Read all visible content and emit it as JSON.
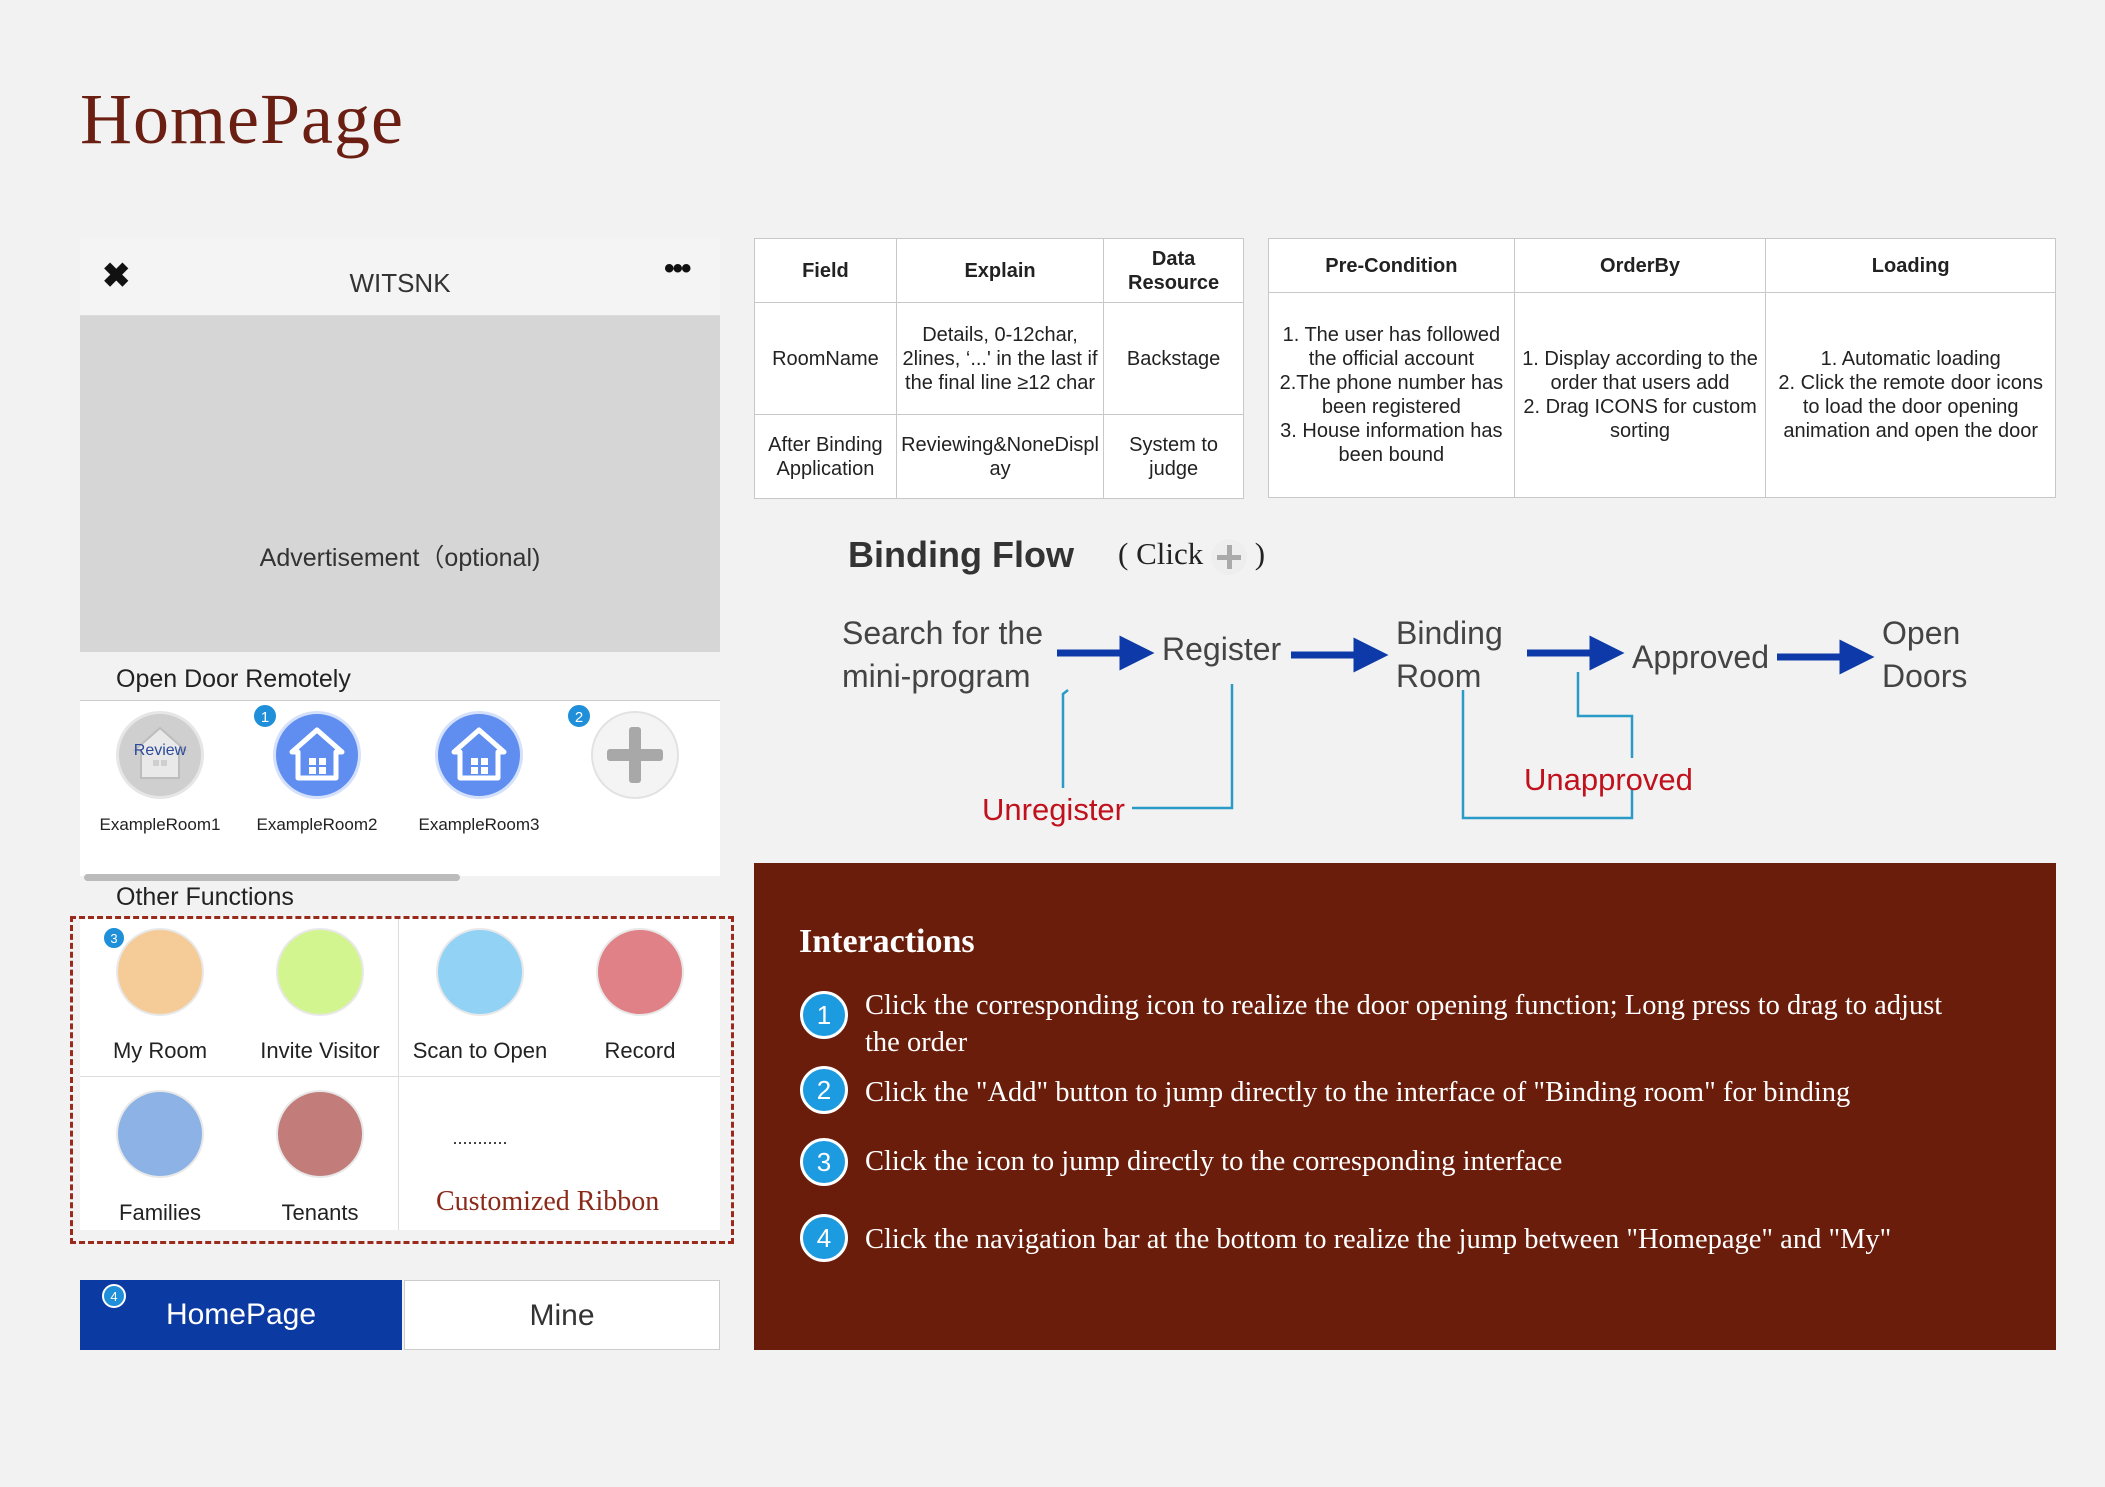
{
  "page": {
    "title": "HomePage"
  },
  "phone": {
    "app_title": "WITSNK",
    "ad_text": "Advertisement（optional)",
    "open_door_label": "Open Door Remotely",
    "rooms": [
      {
        "label": "ExampleRoom1",
        "badge": "",
        "status": "Review"
      },
      {
        "label": "ExampleRoom2",
        "badge": "1",
        "status": ""
      },
      {
        "label": "ExampleRoom3",
        "badge": "",
        "status": ""
      },
      {
        "label": "",
        "badge": "2",
        "status": "add"
      }
    ],
    "other_functions_label": "Other Functions",
    "functions": [
      {
        "label": "My Room",
        "color": "#f5cc98",
        "badge": "3"
      },
      {
        "label": "Invite Visitor",
        "color": "#d3f590"
      },
      {
        "label": "Scan to Open",
        "color": "#92d2f4"
      },
      {
        "label": "Record",
        "color": "#e08187"
      },
      {
        "label": "Families",
        "color": "#8cb2e6"
      },
      {
        "label": "Tenants",
        "color": "#c27d7b"
      },
      {
        "label": "..........."
      }
    ],
    "ribbon_label": "Customized Ribbon",
    "nav": {
      "home": "HomePage",
      "home_badge": "4",
      "mine": "Mine"
    }
  },
  "table1": {
    "headers": [
      "Field",
      "Explain",
      "Data Resource"
    ],
    "rows": [
      [
        "RoomName",
        "Details, 0-12char, 2lines, ‘...' in the last if the final line ≥12 char",
        "Backstage"
      ],
      [
        "After Binding Application",
        "Reviewing&NoneDisplay",
        "System to judge"
      ]
    ]
  },
  "table2": {
    "headers": [
      "Pre-Condition",
      "OrderBy",
      "Loading"
    ],
    "cells": [
      "1. The user has followed the official account\n2.The phone number has been registered\n3. House information has been bound",
      "1. Display according to the order that users  add\n2. Drag ICONS for custom sorting",
      "1. Automatic loading\n2. Click the remote door icons to load the door opening animation and open the door"
    ]
  },
  "flow": {
    "title": "Binding Flow",
    "hint_prefix": "( Click",
    "hint_suffix": ")",
    "steps": [
      "Search for the mini-program",
      "Register",
      "Binding Room",
      "Approved",
      "Open Doors"
    ],
    "branches": [
      "Unregister",
      "Unapproved"
    ],
    "colors": {
      "arrow": "#0d3aa8",
      "branch_line": "#2a9bc7",
      "branch_text": "#c0111c"
    }
  },
  "interactions": {
    "title": "Interactions",
    "items": [
      {
        "num": "1",
        "text": "Click the corresponding icon to realize the door opening function; Long press to drag to adjust the order"
      },
      {
        "num": "2",
        "text": "Click the \"Add\" button to jump directly to the interface of \"Binding room\" for binding"
      },
      {
        "num": "3",
        "text": "Click the icon to jump directly to the corresponding interface"
      },
      {
        "num": "4",
        "text": "Click the navigation bar at the bottom to realize the jump between \"Homepage\" and \"My\""
      }
    ]
  },
  "colors": {
    "title": "#6b1e12",
    "panel": "#6a1d0b",
    "nav_active": "#0b3aa3",
    "accent_blue": "#1d9be0",
    "room_icon": "#5f8ef0"
  }
}
